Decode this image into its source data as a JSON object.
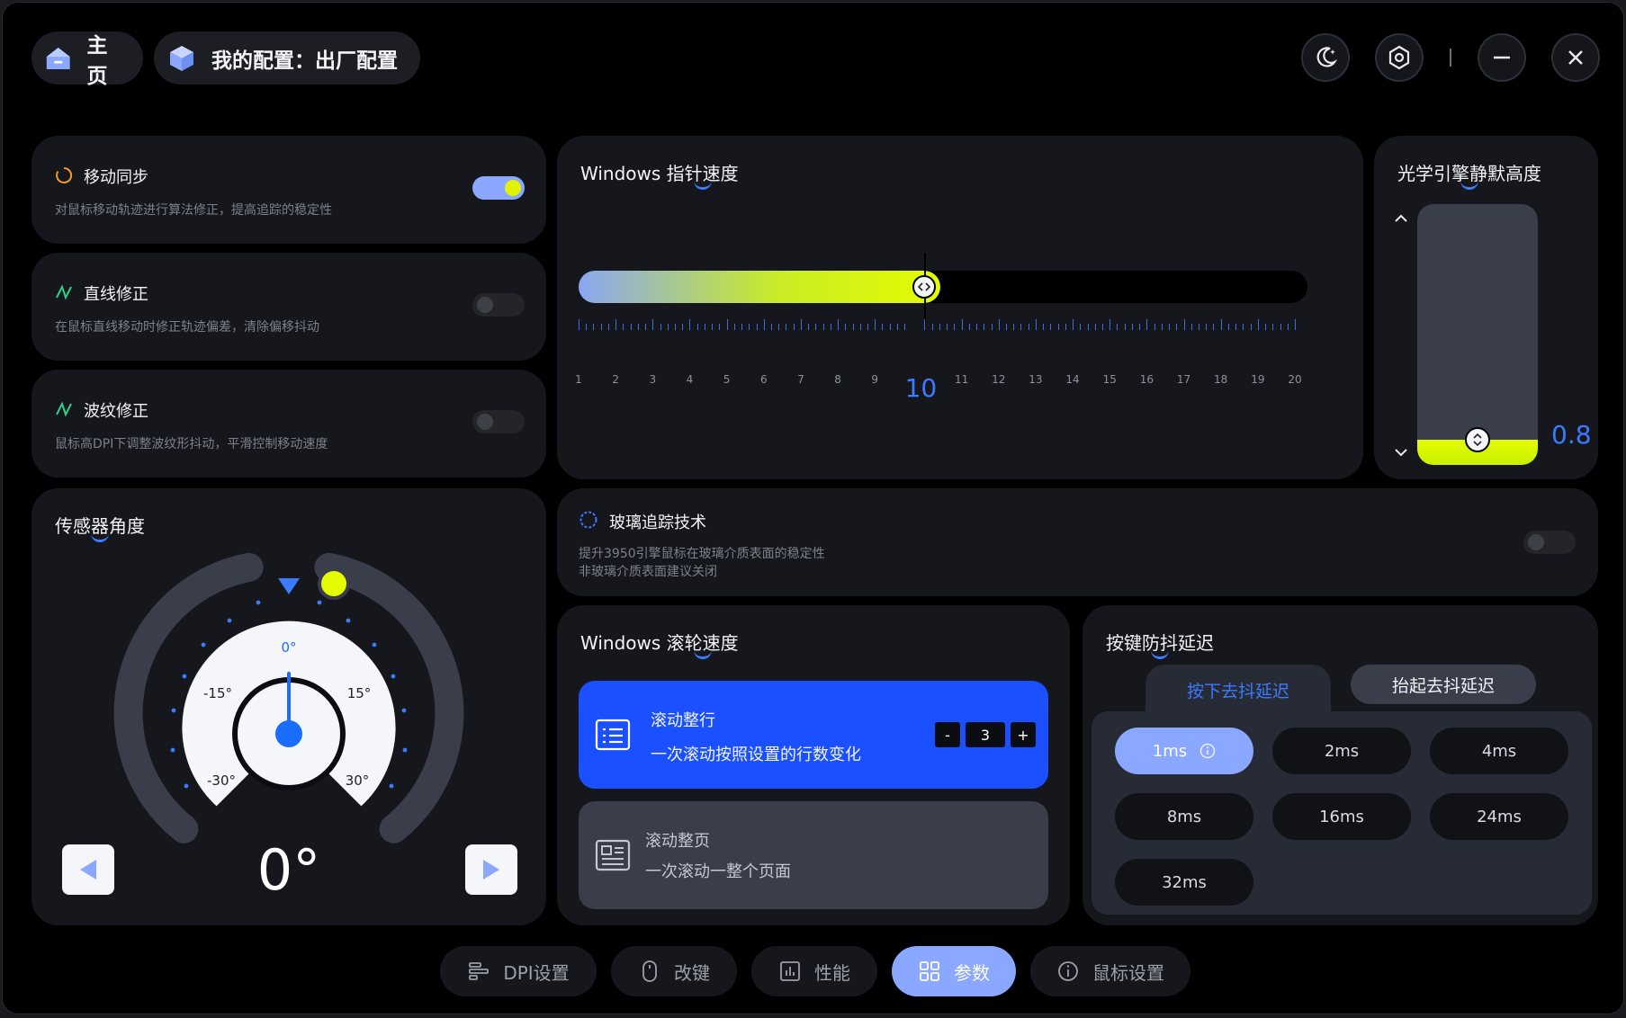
{
  "header": {
    "home_label": "主页",
    "config_label": "我的配置：出厂配置",
    "icons": [
      "home-icon",
      "cube-icon",
      "moon-icon",
      "gear-icon",
      "minimize-icon",
      "close-icon"
    ]
  },
  "motion_sync": {
    "title": "移动同步",
    "desc": "对鼠标移动轨迹进行算法修正，提高追踪的稳定性",
    "enabled": true
  },
  "angle_snapping": {
    "title": "直线修正",
    "desc": "在鼠标直线移动时修正轨迹偏差，清除偏移抖动",
    "enabled": false
  },
  "ripple_control": {
    "title": "波纹修正",
    "desc": "鼠标高DPI下调整波纹形抖动，平滑控制移动速度",
    "enabled": false
  },
  "pointer_speed": {
    "title_prefix": "Windows ",
    "title_main": "指针速度",
    "value": 10,
    "min": 1,
    "max": 20,
    "labels": [
      "1",
      "2",
      "3",
      "4",
      "5",
      "6",
      "7",
      "8",
      "9",
      "10",
      "11",
      "12",
      "13",
      "14",
      "15",
      "16",
      "17",
      "18",
      "19",
      "20"
    ]
  },
  "lod": {
    "title": "光学引擎静默高度",
    "value_text": "0.8",
    "fraction": 0.08
  },
  "sensor_angle": {
    "title": "传感器角度",
    "value_text": "0°",
    "tick_labels": [
      "-30°",
      "-15°",
      "0°",
      "15°",
      "30°"
    ]
  },
  "glass_tracking": {
    "title": "玻璃追踪技术",
    "desc_line1": "提升3950引擎鼠标在玻璃介质表面的稳定性",
    "desc_line2": "非玻璃介质表面建议关闭",
    "enabled": false
  },
  "scroll_speed": {
    "title_prefix": "Windows ",
    "title_main": "滚轮速度",
    "options": [
      {
        "title": "滚动整行",
        "desc": "一次滚动按照设置的行数变化",
        "active": true
      },
      {
        "title": "滚动整页",
        "desc": "一次滚动一整个页面",
        "active": false
      }
    ],
    "stepper": {
      "minus": "-",
      "value": "3",
      "plus": "+"
    }
  },
  "debounce": {
    "title": "按键防抖延迟",
    "tabs": [
      "按下去抖延迟",
      "抬起去抖延迟"
    ],
    "options": [
      "1ms",
      "2ms",
      "4ms",
      "8ms",
      "16ms",
      "24ms",
      "32ms"
    ],
    "selected": "1ms"
  },
  "nav": {
    "items": [
      "DPI设置",
      "改键",
      "性能",
      "参数",
      "鼠标设置"
    ],
    "active": "参数"
  },
  "colors": {
    "accent": "#3b7bff",
    "accent_light": "#8aa8ff",
    "highlight": "#e4fb00",
    "card": "#15171c"
  }
}
